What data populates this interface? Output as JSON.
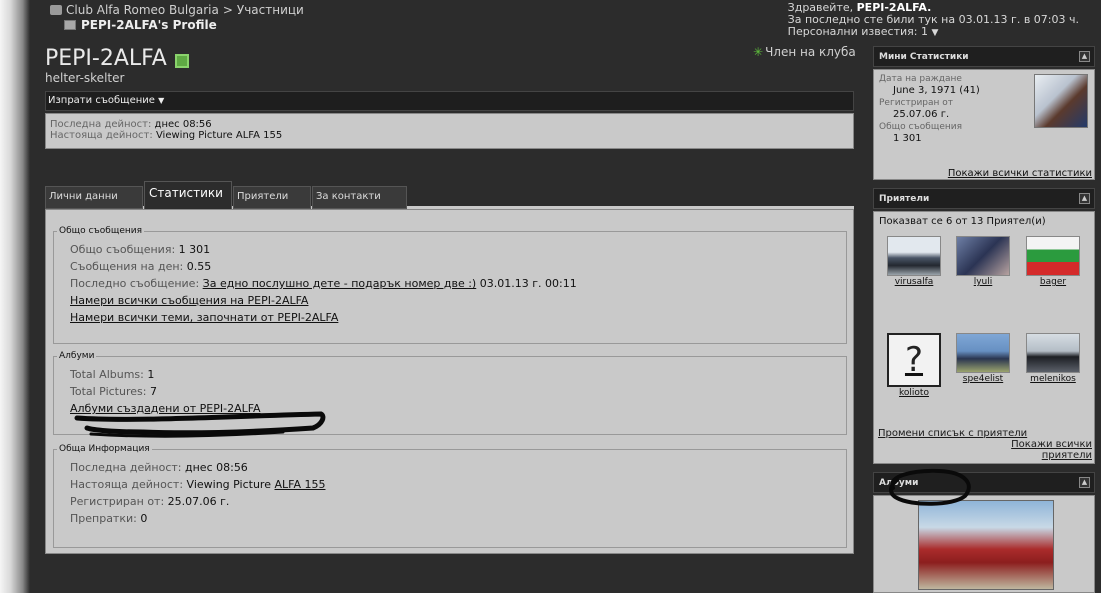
{
  "breadcrumb": {
    "site": "Club Alfa Romeo Bulgaria",
    "separator": ">",
    "section": "Участници",
    "current": "PEPI-2ALFA's Profile"
  },
  "welcome": {
    "greeting": "Здравейте,",
    "username": "PEPI-2ALFA.",
    "last_visit": "За последно сте били тук на 03.01.13 г. в 07:03 ч.",
    "pm_label": "Персонални известия: 1"
  },
  "profile": {
    "username": "PEPI-2ALFA",
    "usertitle": "helter-skelter",
    "membership": "Член на клуба",
    "send_message": "Изпрати съобщение",
    "last_activity_label": "Последна дейност:",
    "last_activity_value": "днес 08:56",
    "current_activity_label": "Настояща дейност:",
    "current_activity_value": "Viewing Picture ALFA 155"
  },
  "tabs": [
    {
      "label": "Лични данни"
    },
    {
      "label": "Статистики"
    },
    {
      "label": "Приятели"
    },
    {
      "label": "За контакти"
    }
  ],
  "stats": {
    "posts_legend": "Общо съобщения",
    "total_posts_label": "Общо съобщения:",
    "total_posts": "1 301",
    "per_day_label": "Съобщения на ден:",
    "per_day": "0.55",
    "last_post_label": "Последно съобщение:",
    "last_post_link": "За едно послушно дете - подарък номер две :)",
    "last_post_date": "03.01.13 г. 00:11",
    "find_posts": "Намери всички съобщения на PEPI-2ALFA",
    "find_threads": "Намери всички теми, започнати от PEPI-2ALFA",
    "albums_legend": "Албуми",
    "total_albums_label": "Total Albums:",
    "total_albums": "1",
    "total_pictures_label": "Total Pictures:",
    "total_pictures": "7",
    "albums_link": "Албуми създадени от PEPI-2ALFA",
    "info_legend": "Обща Информация",
    "info_last_activity_label": "Последна дейност:",
    "info_last_activity": "днес 08:56",
    "info_current_label": "Настояща дейност:",
    "info_current_text": "Viewing Picture",
    "info_current_link": "ALFA 155",
    "joined_label": "Регистриран от:",
    "joined": "25.07.06 г.",
    "referrals_label": "Препратки:",
    "referrals": "0"
  },
  "sidebar": {
    "mini_stats": {
      "title": "Мини Статистики",
      "birthday_label": "Дата на раждане",
      "birthday": "June 3, 1971 (41)",
      "registered_label": "Регистриран от",
      "registered": "25.07.06 г.",
      "posts_label": "Общо съобщения",
      "posts": "1 301",
      "show_all": "Покажи всички статистики"
    },
    "friends": {
      "title": "Приятели",
      "caption": "Показват се 6 от 13 Приятел(и)",
      "list": [
        {
          "name": "virusalfa"
        },
        {
          "name": "lyuli"
        },
        {
          "name": "bager"
        },
        {
          "name": "kolioto"
        },
        {
          "name": "spe4elist"
        },
        {
          "name": "melenikos"
        }
      ],
      "edit": "Промени списък с приятели",
      "show_all": "Покажи всички приятели"
    },
    "albums": {
      "title": "Албуми"
    }
  }
}
